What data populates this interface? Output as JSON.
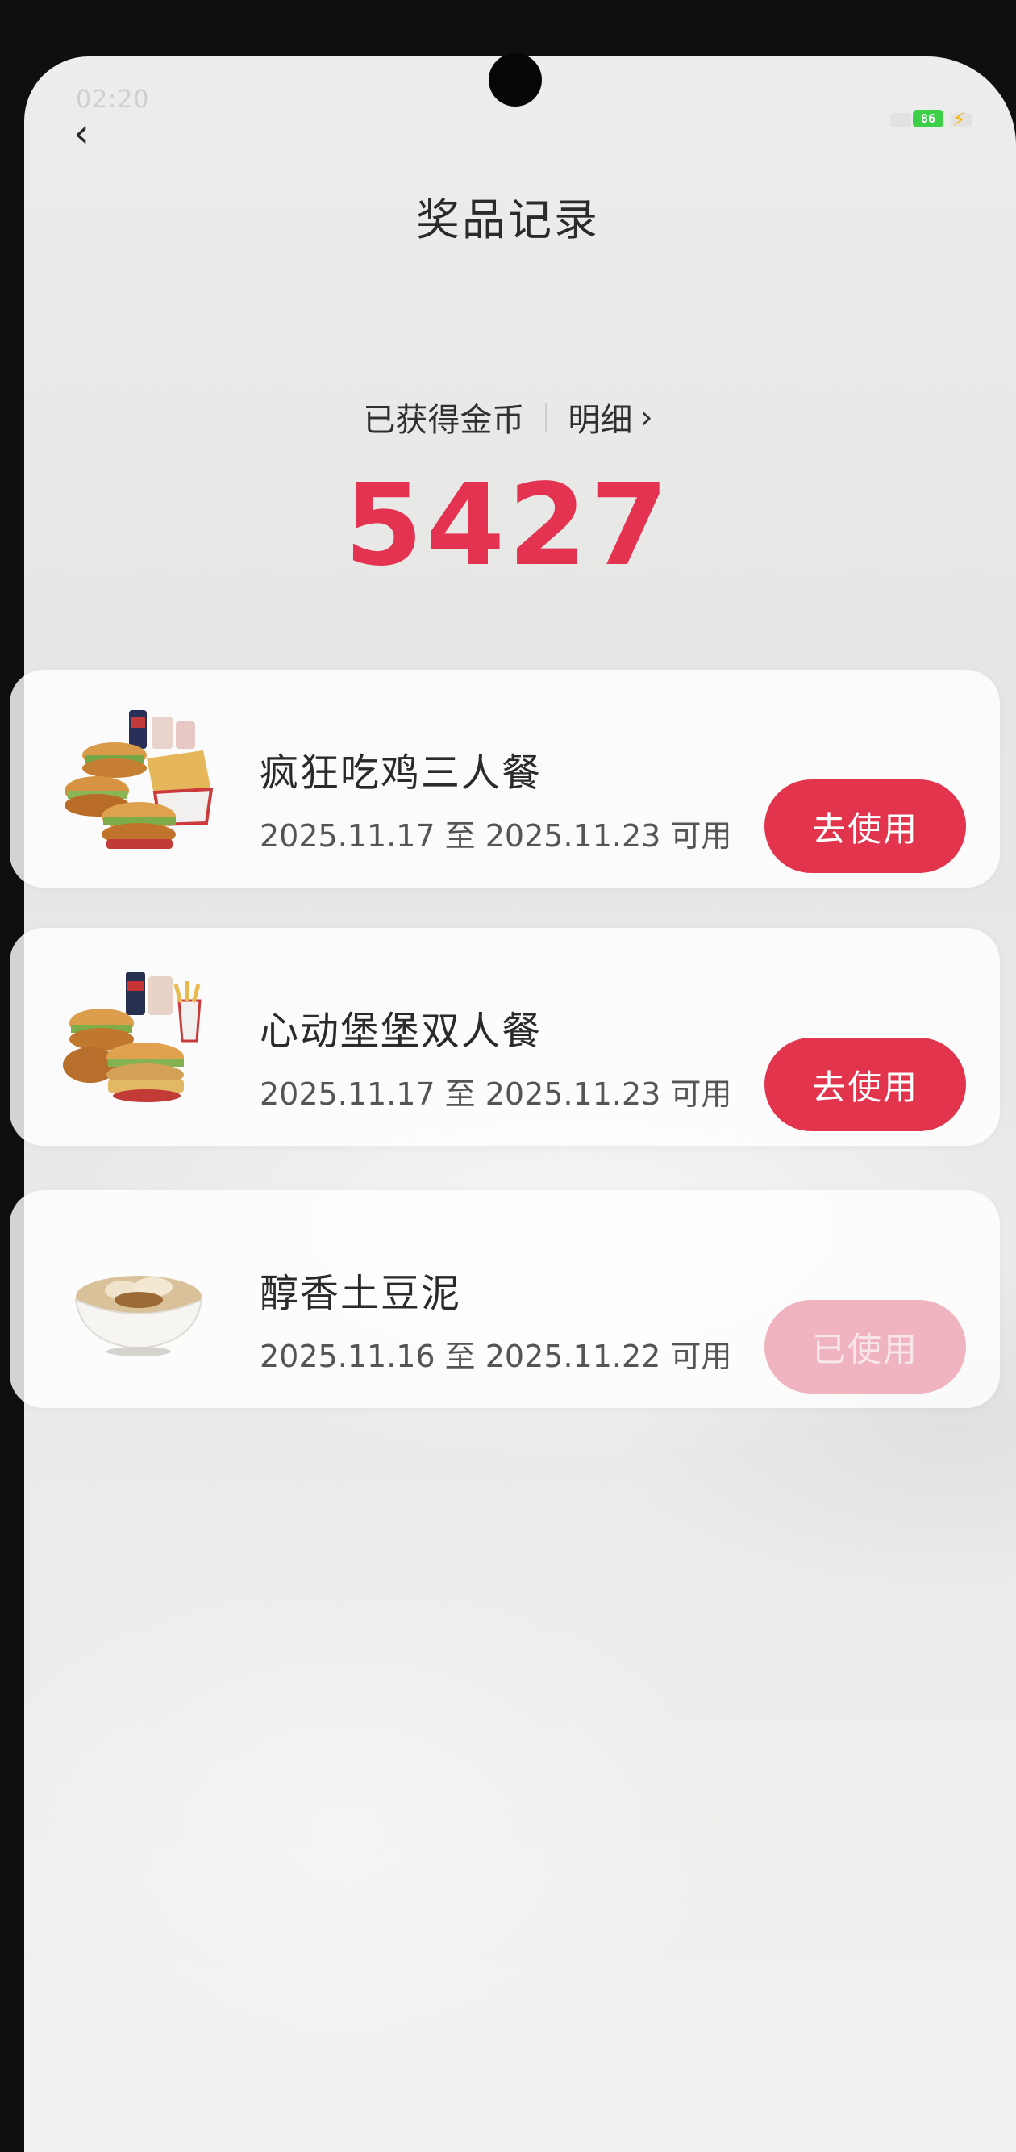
{
  "status": {
    "time": "02:20",
    "battery": "86"
  },
  "header": {
    "title": "奖品记录"
  },
  "coins": {
    "label": "已获得金币",
    "detail_label": "明细",
    "amount": "5427"
  },
  "colors": {
    "accent": "#e33351",
    "button": "#e2354d",
    "button_used": "#efb4bf"
  },
  "prizes": [
    {
      "name": "疯狂吃鸡三人餐",
      "period": "2025.11.17 至 2025.11.23 可用",
      "button": "去使用",
      "state": "active",
      "image": "chicken-meal-image"
    },
    {
      "name": "心动堡堡双人餐",
      "period": "2025.11.17 至 2025.11.23 可用",
      "button": "去使用",
      "state": "active",
      "image": "burger-meal-image"
    },
    {
      "name": "醇香土豆泥",
      "period": "2025.11.16 至 2025.11.22 可用",
      "button": "已使用",
      "state": "used",
      "image": "mashed-potato-image"
    }
  ]
}
